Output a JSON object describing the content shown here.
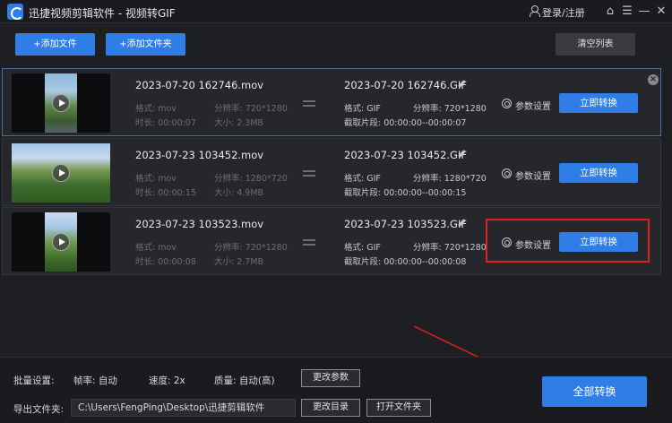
{
  "titlebar": {
    "app_name": "迅捷视频剪辑软件 - 视频转GIF",
    "login_label": "登录/注册"
  },
  "toolbar": {
    "add_file_label": "+添加文件",
    "add_folder_label": "+添加文件夹",
    "clear_list_label": "清空列表"
  },
  "files": [
    {
      "src_name": "2023-07-20 162746.mov",
      "src_format": "格式: mov",
      "src_resolution": "分辨率: 720*1280",
      "src_duration": "时长: 00:00:07",
      "src_size": "大小: 2.3MB",
      "dst_name": "2023-07-20 162746.GIF",
      "dst_format": "格式: GIF",
      "dst_resolution": "分辨率: 720*1280",
      "dst_clip": "截取片段: 00:00:00--00:00:07",
      "settings_label": "参数设置",
      "convert_label": "立即转换"
    },
    {
      "src_name": "2023-07-23 103452.mov",
      "src_format": "格式: mov",
      "src_resolution": "分辨率: 1280*720",
      "src_duration": "时长: 00:00:15",
      "src_size": "大小: 4.9MB",
      "dst_name": "2023-07-23 103452.GIF",
      "dst_format": "格式: GIF",
      "dst_resolution": "分辨率: 1280*720",
      "dst_clip": "截取片段: 00:00:00--00:00:15",
      "settings_label": "参数设置",
      "convert_label": "立即转换"
    },
    {
      "src_name": "2023-07-23 103523.mov",
      "src_format": "格式: mov",
      "src_resolution": "分辨率: 720*1280",
      "src_duration": "时长: 00:00:08",
      "src_size": "大小: 2.7MB",
      "dst_name": "2023-07-23 103523.GIF",
      "dst_format": "格式: GIF",
      "dst_resolution": "分辨率: 720*1280",
      "dst_clip": "截取片段: 00:00:00--00:00:08",
      "settings_label": "参数设置",
      "convert_label": "立即转换"
    }
  ],
  "batch": {
    "label": "批量设置:",
    "framerate": "帧率: 自动",
    "speed": "速度: 2x",
    "quality": "质量: 自动(高)",
    "change_params_label": "更改参数"
  },
  "export": {
    "label": "导出文件夹:",
    "path": "C:\\Users\\FengPing\\Desktop\\迅捷剪辑软件",
    "change_dir_label": "更改目录",
    "open_folder_label": "打开文件夹"
  },
  "convert_all_label": "全部转换",
  "colors": {
    "accent": "#2f7ee8",
    "highlight": "#e02020",
    "background": "#1e1f23"
  }
}
